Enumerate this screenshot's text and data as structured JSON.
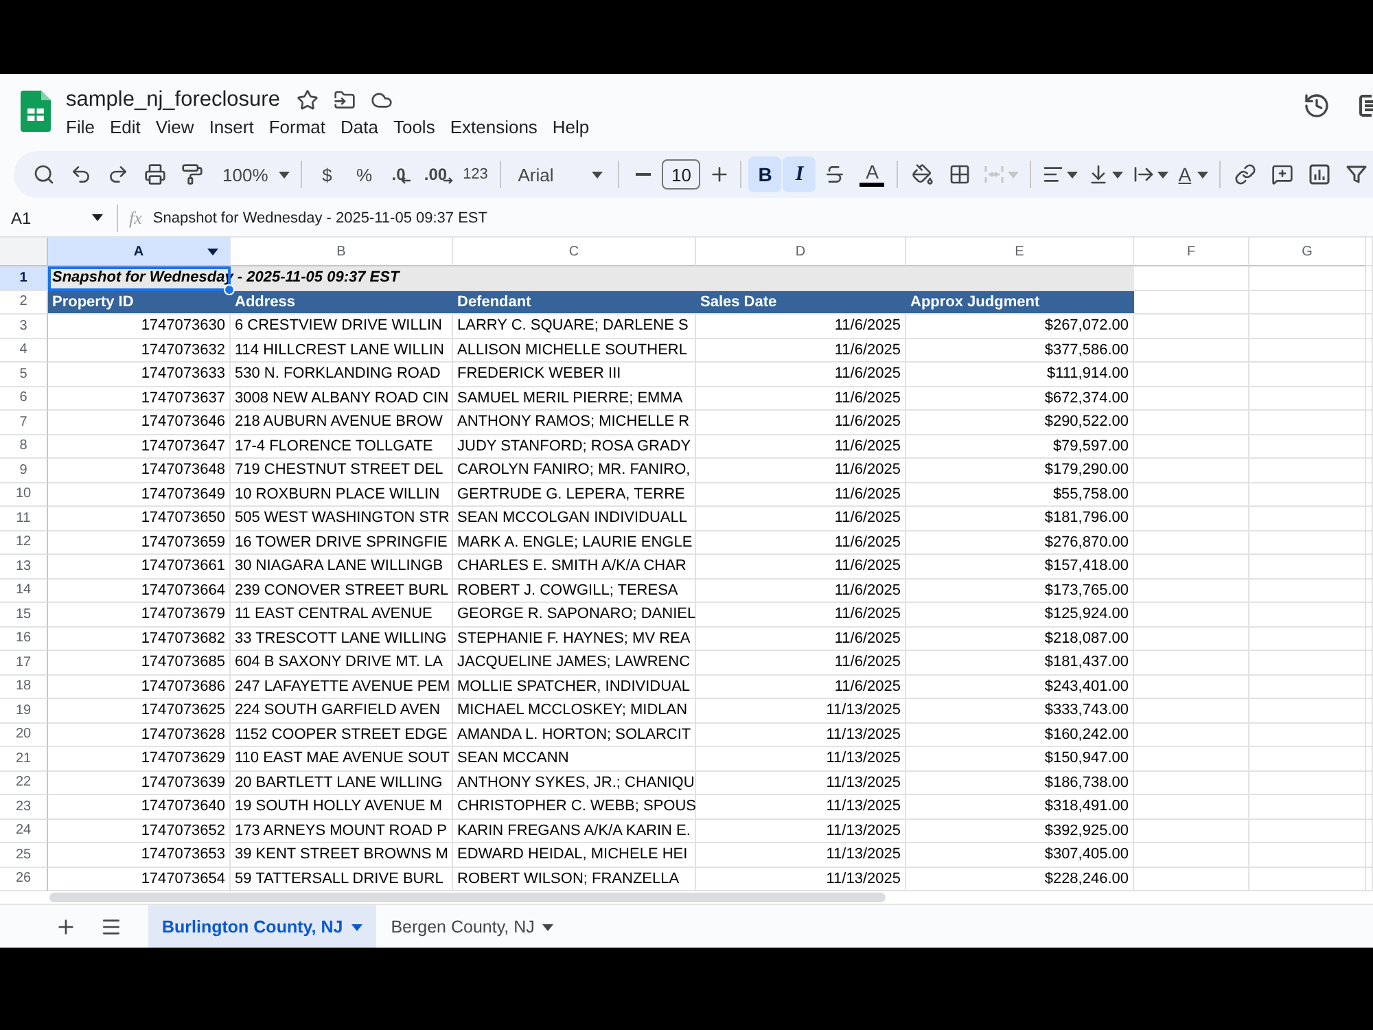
{
  "document": {
    "title": "sample_nj_foreclosure"
  },
  "menu": [
    "File",
    "Edit",
    "View",
    "Insert",
    "Format",
    "Data",
    "Tools",
    "Extensions",
    "Help"
  ],
  "toolbar": {
    "zoom": "100%",
    "currency": "$",
    "percent": "%",
    "decrease_decimals": ".0",
    "increase_decimals": ".00",
    "number_format": "123",
    "font": "Arial",
    "font_size": "10",
    "bold": {
      "label": "B",
      "on": true
    },
    "italic": {
      "label": "I",
      "on": true
    },
    "text_color": {
      "label": "A"
    },
    "merge": {
      "disabled": true
    },
    "text_rotation": {
      "label": "A"
    }
  },
  "formula_bar": {
    "cell_ref": "A1",
    "function_label": "fx",
    "value": "Snapshot for Wednesday - 2025-11-05 09:37 EST"
  },
  "sheet": {
    "columns": [
      {
        "label": "A",
        "selected": true
      },
      {
        "label": "B",
        "selected": false
      },
      {
        "label": "C",
        "selected": false
      },
      {
        "label": "D",
        "selected": false
      },
      {
        "label": "E",
        "selected": false
      },
      {
        "label": "F",
        "selected": false
      },
      {
        "label": "G",
        "selected": false
      }
    ],
    "rows": [
      {
        "kind": "title",
        "number": "1",
        "selected": true,
        "cells": [
          "Snapshot for Wednesday - 2025-11-05 09:37 EST"
        ]
      },
      {
        "kind": "header",
        "number": "2",
        "selected": false,
        "cells": [
          "Property ID",
          "Address",
          "Defendant",
          "Sales Date",
          "Approx Judgment"
        ]
      },
      {
        "kind": "data",
        "number": "3",
        "selected": false,
        "cells": [
          "1747073630",
          "6 CRESTVIEW DRIVE WILLIN",
          "LARRY C. SQUARE; DARLENE S",
          "11/6/2025",
          "$267,072.00"
        ]
      },
      {
        "kind": "data",
        "number": "4",
        "selected": false,
        "cells": [
          "1747073632",
          "114 HILLCREST LANE WILLIN",
          "ALLISON MICHELLE SOUTHERL",
          "11/6/2025",
          "$377,586.00"
        ]
      },
      {
        "kind": "data",
        "number": "5",
        "selected": false,
        "cells": [
          "1747073633",
          "530 N. FORKLANDING ROAD",
          "FREDERICK WEBER III",
          "11/6/2025",
          "$111,914.00"
        ]
      },
      {
        "kind": "data",
        "number": "6",
        "selected": false,
        "cells": [
          "1747073637",
          "3008 NEW ALBANY ROAD CIN",
          "SAMUEL MERIL PIERRE; EMMA",
          "11/6/2025",
          "$672,374.00"
        ]
      },
      {
        "kind": "data",
        "number": "7",
        "selected": false,
        "cells": [
          "1747073646",
          "218 AUBURN AVENUE BROW",
          "ANTHONY RAMOS; MICHELLE R",
          "11/6/2025",
          "$290,522.00"
        ]
      },
      {
        "kind": "data",
        "number": "8",
        "selected": false,
        "cells": [
          "1747073647",
          "17-4 FLORENCE TOLLGATE",
          "JUDY STANFORD; ROSA GRADY",
          "11/6/2025",
          "$79,597.00"
        ]
      },
      {
        "kind": "data",
        "number": "9",
        "selected": false,
        "cells": [
          "1747073648",
          "719 CHESTNUT STREET DEL",
          "CAROLYN FANIRO; MR. FANIRO,",
          "11/6/2025",
          "$179,290.00"
        ]
      },
      {
        "kind": "data",
        "number": "10",
        "selected": false,
        "cells": [
          "1747073649",
          "10 ROXBURN PLACE WILLIN",
          "GERTRUDE G. LEPERA, TERRE",
          "11/6/2025",
          "$55,758.00"
        ]
      },
      {
        "kind": "data",
        "number": "11",
        "selected": false,
        "cells": [
          "1747073650",
          "505 WEST WASHINGTON STR",
          "SEAN MCCOLGAN INDIVIDUALL",
          "11/6/2025",
          "$181,796.00"
        ]
      },
      {
        "kind": "data",
        "number": "12",
        "selected": false,
        "cells": [
          "1747073659",
          "16 TOWER DRIVE SPRINGFIE",
          "MARK A. ENGLE; LAURIE ENGLE",
          "11/6/2025",
          "$276,870.00"
        ]
      },
      {
        "kind": "data",
        "number": "13",
        "selected": false,
        "cells": [
          "1747073661",
          "30 NIAGARA LANE WILLINGB",
          "CHARLES E. SMITH A/K/A CHAR",
          "11/6/2025",
          "$157,418.00"
        ]
      },
      {
        "kind": "data",
        "number": "14",
        "selected": false,
        "cells": [
          "1747073664",
          "239 CONOVER STREET BURL",
          "ROBERT J. COWGILL; TERESA",
          "11/6/2025",
          "$173,765.00"
        ]
      },
      {
        "kind": "data",
        "number": "15",
        "selected": false,
        "cells": [
          "1747073679",
          "11 EAST CENTRAL AVENUE",
          "GEORGE R. SAPONARO; DANIEL",
          "11/6/2025",
          "$125,924.00"
        ]
      },
      {
        "kind": "data",
        "number": "16",
        "selected": false,
        "cells": [
          "1747073682",
          "33 TRESCOTT LANE WILLING",
          "STEPHANIE F. HAYNES; MV REA",
          "11/6/2025",
          "$218,087.00"
        ]
      },
      {
        "kind": "data",
        "number": "17",
        "selected": false,
        "cells": [
          "1747073685",
          "604 B SAXONY DRIVE MT. LA",
          "JACQUELINE JAMES; LAWRENC",
          "11/6/2025",
          "$181,437.00"
        ]
      },
      {
        "kind": "data",
        "number": "18",
        "selected": false,
        "cells": [
          "1747073686",
          "247 LAFAYETTE AVENUE PEM",
          "MOLLIE SPATCHER, INDIVIDUAL",
          "11/6/2025",
          "$243,401.00"
        ]
      },
      {
        "kind": "data",
        "number": "19",
        "selected": false,
        "cells": [
          "1747073625",
          "224 SOUTH GARFIELD AVEN",
          "MICHAEL MCCLOSKEY; MIDLAN",
          "11/13/2025",
          "$333,743.00"
        ]
      },
      {
        "kind": "data",
        "number": "20",
        "selected": false,
        "cells": [
          "1747073628",
          "1152 COOPER STREET EDGE",
          "AMANDA L. HORTON; SOLARCIT",
          "11/13/2025",
          "$160,242.00"
        ]
      },
      {
        "kind": "data",
        "number": "21",
        "selected": false,
        "cells": [
          "1747073629",
          "110 EAST MAE AVENUE SOUT",
          "SEAN MCCANN",
          "11/13/2025",
          "$150,947.00"
        ]
      },
      {
        "kind": "data",
        "number": "22",
        "selected": false,
        "cells": [
          "1747073639",
          "20 BARTLETT LANE WILLING",
          "ANTHONY SYKES, JR.; CHANIQU",
          "11/13/2025",
          "$186,738.00"
        ]
      },
      {
        "kind": "data",
        "number": "23",
        "selected": false,
        "cells": [
          "1747073640",
          "19 SOUTH HOLLY AVENUE M",
          "CHRISTOPHER C. WEBB; SPOUS",
          "11/13/2025",
          "$318,491.00"
        ]
      },
      {
        "kind": "data",
        "number": "24",
        "selected": false,
        "cells": [
          "1747073652",
          "173 ARNEYS MOUNT ROAD P",
          "KARIN FREGANS A/K/A KARIN E.",
          "11/13/2025",
          "$392,925.00"
        ]
      },
      {
        "kind": "data",
        "number": "25",
        "selected": false,
        "cells": [
          "1747073653",
          "39 KENT STREET BROWNS M",
          "EDWARD HEIDAL, MICHELE HEI",
          "11/13/2025",
          "$307,405.00"
        ]
      },
      {
        "kind": "data",
        "number": "26",
        "selected": false,
        "cells": [
          "1747073654",
          "59 TATTERSALL DRIVE BURL",
          "ROBERT WILSON; FRANZELLA",
          "11/13/2025",
          "$228,246.00"
        ]
      }
    ]
  },
  "sheet_tabs": [
    {
      "label": "Burlington County, NJ",
      "selected": true
    },
    {
      "label": "Bergen County, NJ",
      "selected": false
    }
  ]
}
